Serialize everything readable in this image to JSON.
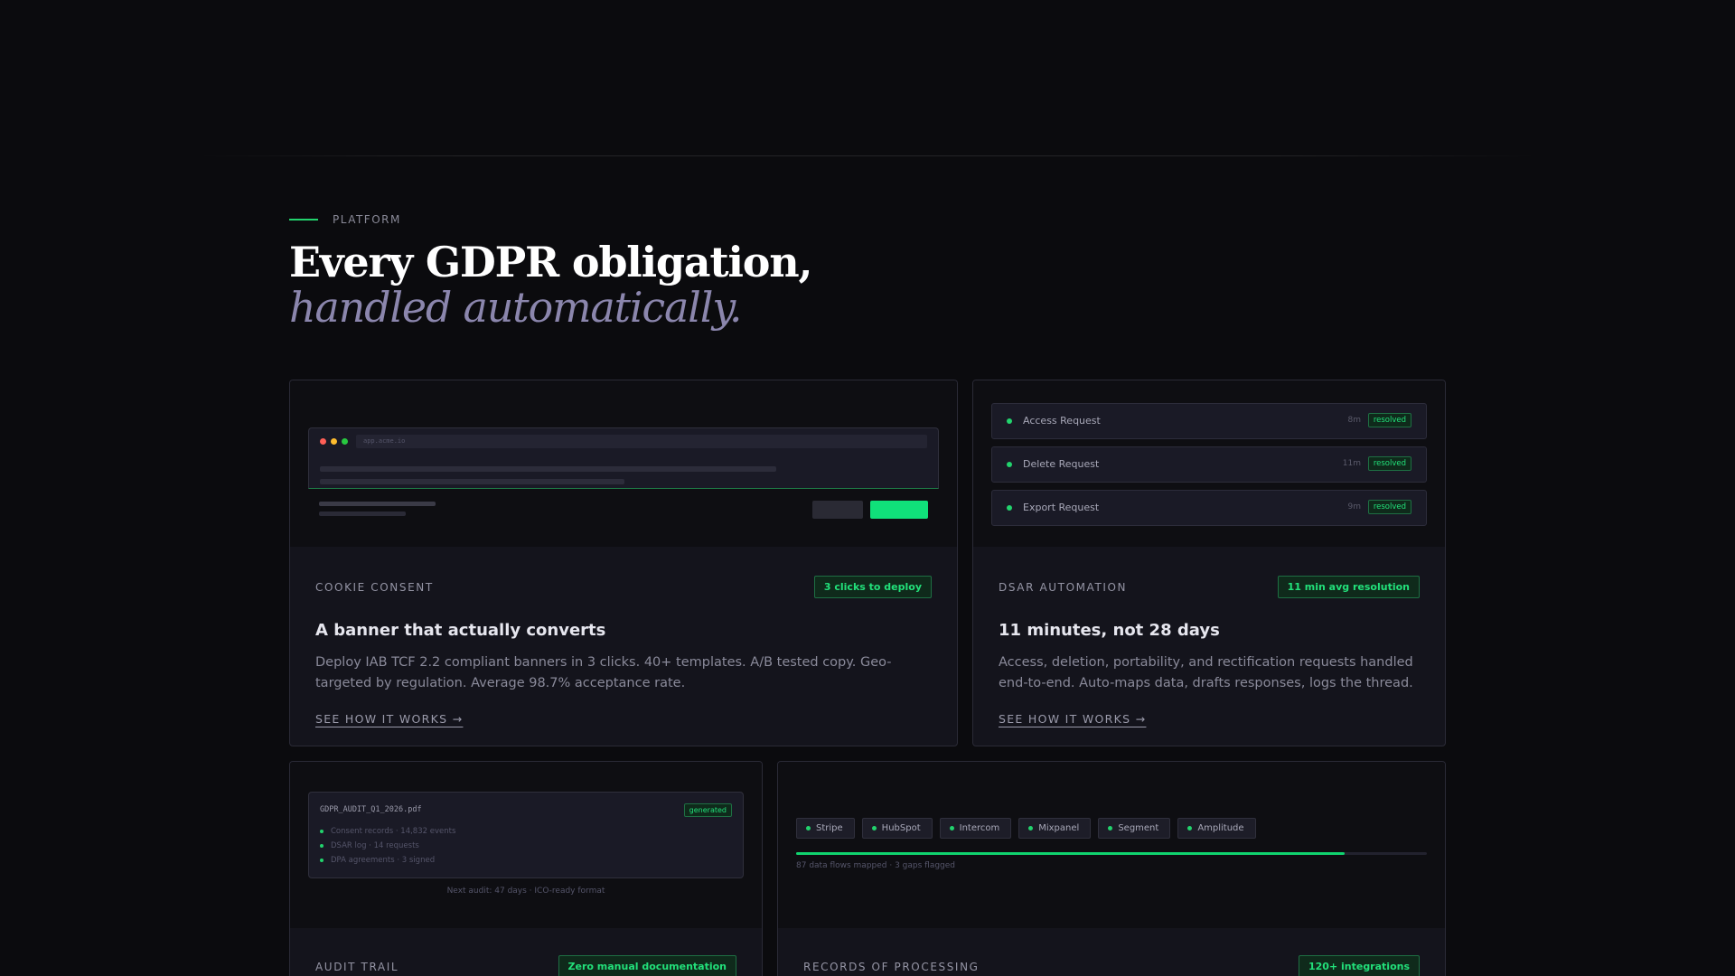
{
  "section": {
    "eyebrow": "PLATFORM",
    "headline_line1": "Every GDPR obligation,",
    "headline_line2": "handled automatically."
  },
  "cards": {
    "cookie": {
      "category": "COOKIE CONSENT",
      "badge": "3 clicks to deploy",
      "title": "A banner that actually converts",
      "description": "Deploy IAB TCF 2.2 compliant banners in 3 clicks. 40+ templates. A/B tested copy. Geo-targeted by regulation. Average 98.7% acceptance rate.",
      "link": "SEE HOW IT WORKS →",
      "mock_url": "app.acme.io"
    },
    "dsar": {
      "category": "DSAR AUTOMATION",
      "badge": "11 min avg resolution",
      "title": "11 minutes, not 28 days",
      "description": "Access, deletion, portability, and rectification requests handled end-to-end. Auto-maps data, drafts responses, logs the thread.",
      "link": "SEE HOW IT WORKS →",
      "requests": [
        {
          "label": "Access Request",
          "time": "8m",
          "status": "resolved"
        },
        {
          "label": "Delete Request",
          "time": "11m",
          "status": "resolved"
        },
        {
          "label": "Export Request",
          "time": "9m",
          "status": "resolved"
        }
      ]
    },
    "audit": {
      "category": "AUDIT TRAIL",
      "badge": "Zero manual documentation",
      "doc_name": "GDPR_AUDIT_Q1_2026.pdf",
      "doc_status": "generated",
      "doc_items": [
        "Consent records · 14,832 events",
        "DSAR log · 14 requests",
        "DPA agreements · 3 signed"
      ],
      "footnote": "Next audit: 47 days · ICO-ready format"
    },
    "records": {
      "category": "RECORDS OF PROCESSING",
      "badge": "120+ integrations",
      "integrations": [
        "Stripe",
        "HubSpot",
        "Intercom",
        "Mixpanel",
        "Segment",
        "Amplitude"
      ],
      "mapping_progress": 0.87,
      "caption": "87 data flows mapped · 3 gaps flagged"
    }
  },
  "colors": {
    "accent": "#22d36d",
    "background": "#0b0b0e",
    "card": "#14141c",
    "muted_italic": "#8b86ad"
  }
}
